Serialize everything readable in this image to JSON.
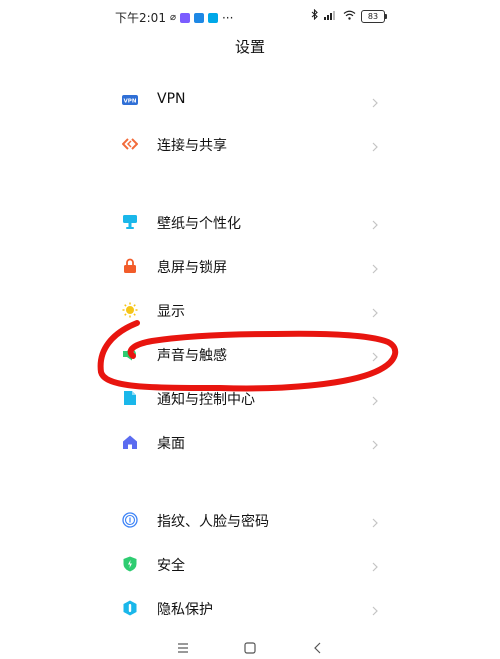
{
  "status_bar": {
    "time": "下午2:01",
    "more": "···",
    "battery_level": "83",
    "colors": {
      "app1": "#7b5cff",
      "app2": "#1e88e5",
      "app3": "#00a8e8"
    }
  },
  "header": {
    "title": "设置"
  },
  "sections": [
    {
      "items": [
        {
          "label": "VPN",
          "icon": "vpn-icon",
          "color": "#2f6fd6"
        },
        {
          "label": "连接与共享",
          "icon": "connection-sharing-icon",
          "color": "#f26b3a"
        }
      ]
    },
    {
      "items": [
        {
          "label": "壁纸与个性化",
          "icon": "wallpaper-icon",
          "color": "#1ab7ea"
        },
        {
          "label": "息屏与锁屏",
          "icon": "lock-screen-icon",
          "color": "#f25c2a"
        },
        {
          "label": "显示",
          "icon": "display-brightness-icon",
          "color": "#f5c518"
        },
        {
          "label": "声音与触感",
          "icon": "sound-icon",
          "color": "#2ecc71"
        },
        {
          "label": "通知与控制中心",
          "icon": "notification-icon",
          "color": "#1ab7ea"
        },
        {
          "label": "桌面",
          "icon": "home-icon",
          "color": "#5b6cf0"
        }
      ]
    },
    {
      "items": [
        {
          "label": "指纹、人脸与密码",
          "icon": "fingerprint-icon",
          "color": "#3b82f6"
        },
        {
          "label": "安全",
          "icon": "security-shield-icon",
          "color": "#2ecc71"
        },
        {
          "label": "隐私保护",
          "icon": "privacy-icon",
          "color": "#1ab7ea"
        }
      ]
    }
  ],
  "nav_bar": {
    "menu_icon": "menu-icon",
    "home_icon": "home-square-icon",
    "back_icon": "back-icon"
  },
  "annotation": {
    "color": "#e8150f"
  }
}
